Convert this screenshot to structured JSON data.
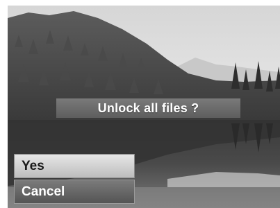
{
  "dialog": {
    "message": "Unlock all files ?"
  },
  "menu": {
    "items": [
      {
        "label": "Yes",
        "selected": false
      },
      {
        "label": "Cancel",
        "selected": true
      }
    ]
  },
  "colors": {
    "dialog_bg": "#6b6b6b",
    "option_normal_bg": "#d2d2d2",
    "option_selected_bg": "#666666"
  }
}
